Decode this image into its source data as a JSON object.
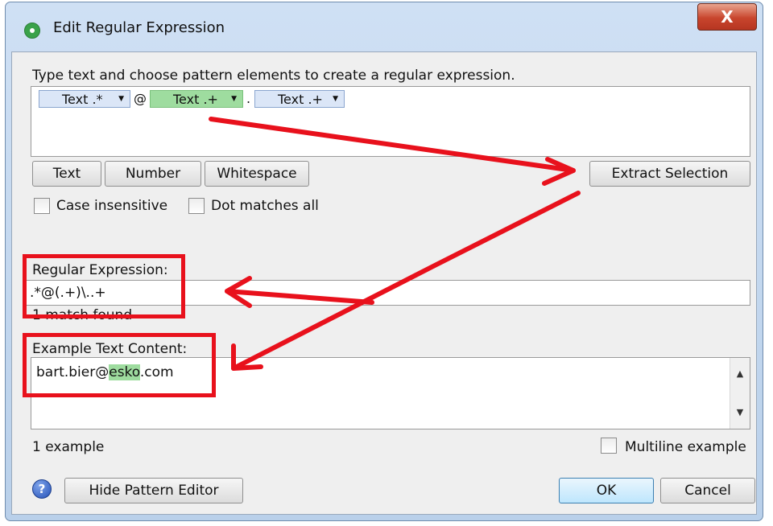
{
  "window": {
    "title": "Edit Regular Expression",
    "close_label": "X"
  },
  "pattern_editor": {
    "instruction": "Type text and choose pattern elements to create a regular expression.",
    "elements": [
      {
        "label": "Text .*",
        "color": "#dbe6f7"
      },
      {
        "label": "@",
        "type": "literal"
      },
      {
        "label": "Text .+",
        "color": "#9edc9f"
      },
      {
        "label": ".",
        "type": "literal"
      },
      {
        "label": "Text .+",
        "color": "#dbe6f7"
      }
    ],
    "buttons": {
      "text": "Text",
      "number": "Number",
      "whitespace": "Whitespace",
      "extract": "Extract Selection"
    },
    "case_insensitive_label": "Case insensitive",
    "dot_matches_all_label": "Dot matches all"
  },
  "regex": {
    "label": "Regular Expression:",
    "value": ".*@(.+)\\..+",
    "status": "1 match found"
  },
  "example": {
    "label": "Example Text Content:",
    "text_before": "bart.bier@",
    "text_highlight": "esko",
    "text_after": ".com",
    "highlight_color": "#9edc9f",
    "count": "1 example",
    "multiline_label": "Multiline example"
  },
  "footer": {
    "hide_pattern_label": "Hide Pattern Editor",
    "ok_label": "OK",
    "cancel_label": "Cancel"
  },
  "annotation_color": "#e8111c"
}
